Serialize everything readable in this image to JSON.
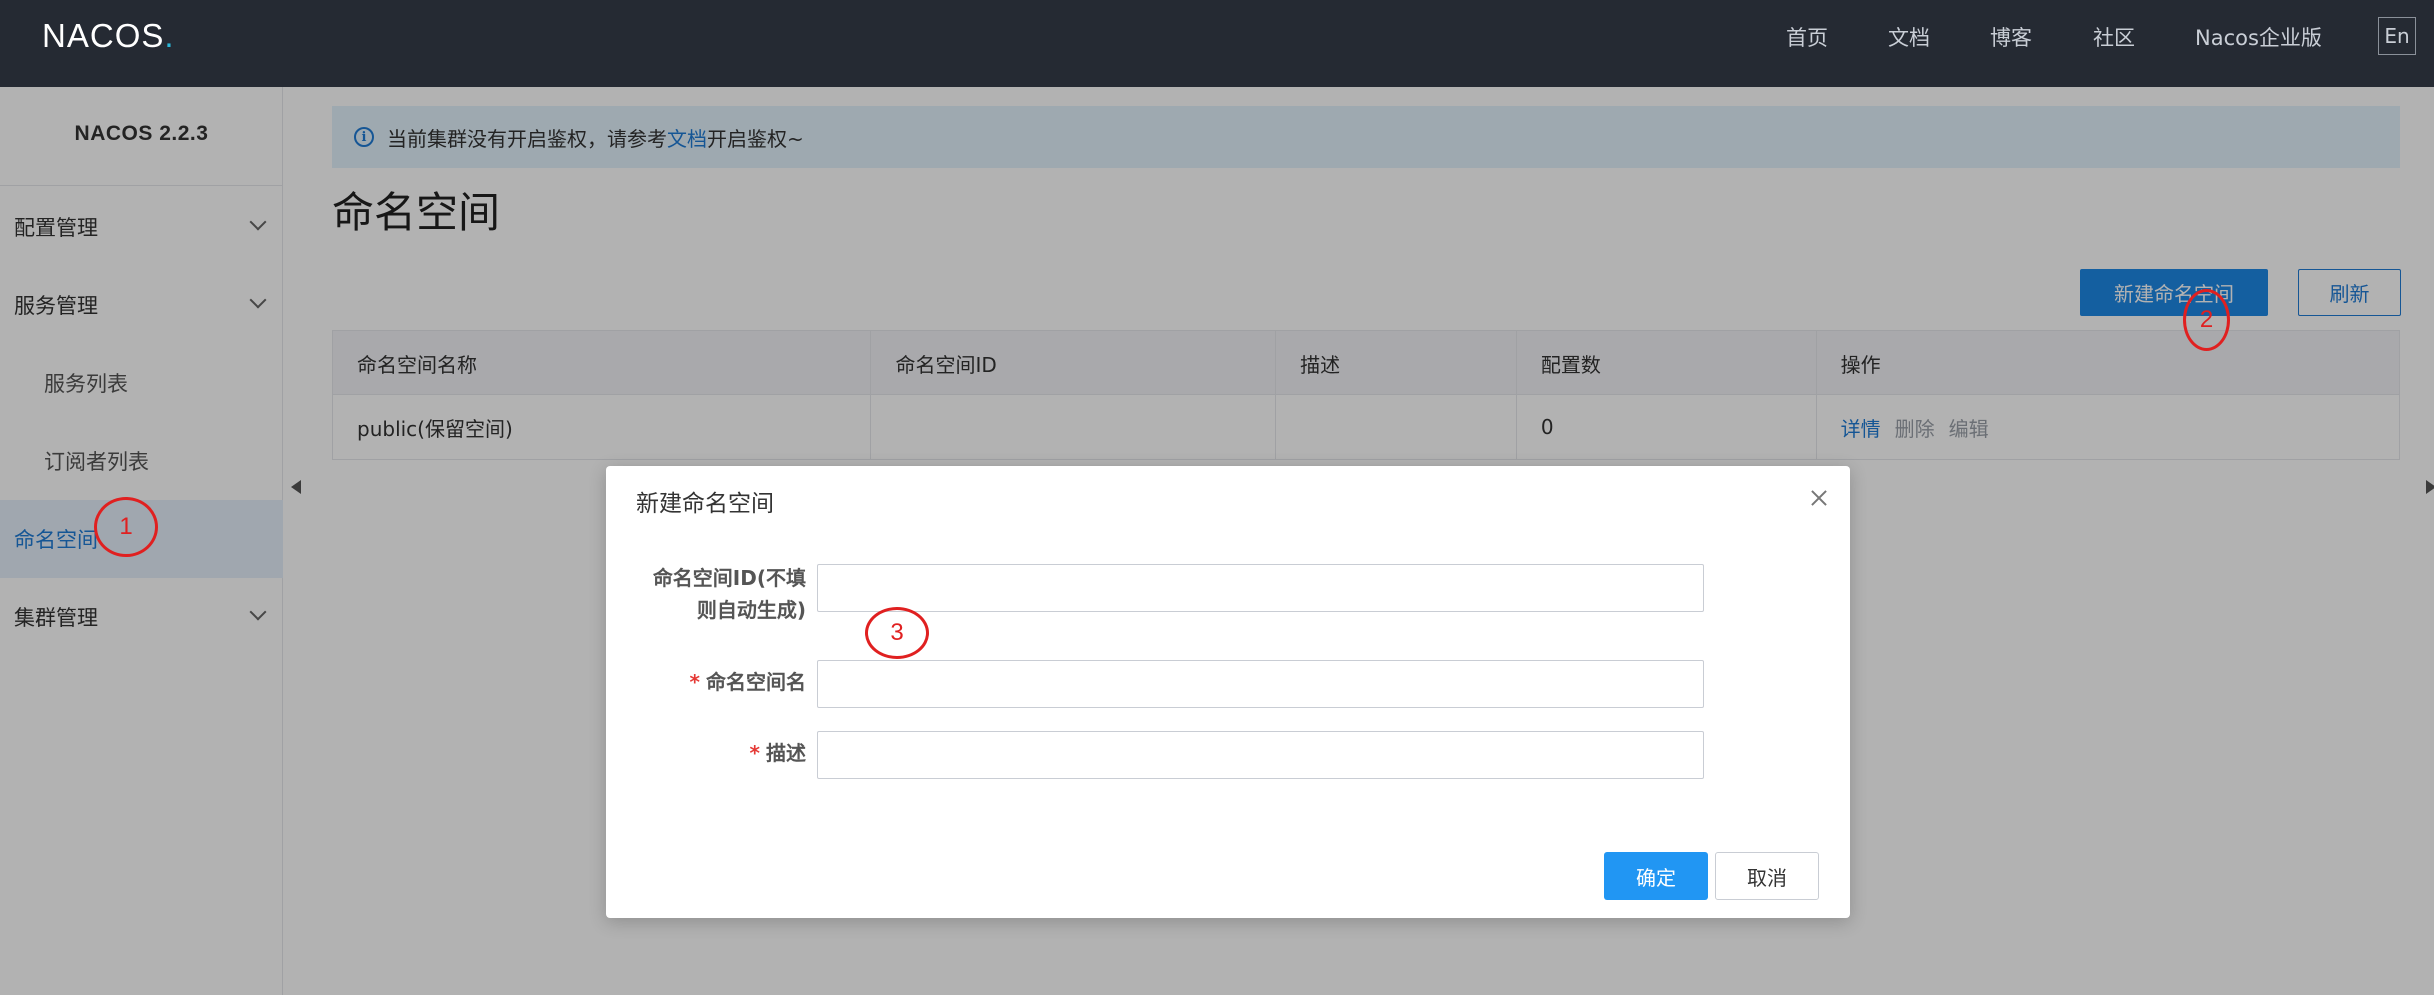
{
  "app": {
    "logo_text_a": "NAC",
    "logo_text_b": "OS",
    "logo_dot": "."
  },
  "topnav": {
    "items": [
      "首页",
      "文档",
      "博客",
      "社区",
      "Nacos企业版"
    ],
    "lang": "En"
  },
  "sidebar": {
    "version": "NACOS 2.2.3",
    "items": [
      {
        "label": "配置管理",
        "expandable": true
      },
      {
        "label": "服务管理",
        "expandable": true
      },
      {
        "label": "服务列表",
        "sub": true
      },
      {
        "label": "订阅者列表",
        "sub": true
      },
      {
        "label": "命名空间",
        "active": true
      },
      {
        "label": "集群管理",
        "expandable": true
      }
    ]
  },
  "alert": {
    "text_before": "当前集群没有开启鉴权，请参考",
    "link": "文档",
    "text_after": "开启鉴权~",
    "icon": "info-icon"
  },
  "page": {
    "title": "命名空间",
    "new_button": "新建命名空间",
    "refresh_button": "刷新"
  },
  "table": {
    "headers": [
      "命名空间名称",
      "命名空间ID",
      "描述",
      "配置数",
      "操作"
    ],
    "rows": [
      {
        "name": "public(保留空间)",
        "id": "",
        "desc": "",
        "count": "0",
        "ops": [
          "详情",
          "删除",
          "编辑"
        ]
      }
    ]
  },
  "dialog": {
    "title": "新建命名空间",
    "fields": [
      {
        "label_line1": "命名空间ID(不填",
        "label_line2": "则自动生成)",
        "required": false,
        "value": ""
      },
      {
        "label": "命名空间名",
        "required": true,
        "value": ""
      },
      {
        "label": "描述",
        "required": true,
        "value": ""
      }
    ],
    "ok": "确定",
    "cancel": "取消"
  },
  "annotations": [
    "1",
    "2",
    "3"
  ],
  "colors": {
    "topbar": "#252a33",
    "accent": "#1e88e5",
    "annotation": "#e02020"
  }
}
